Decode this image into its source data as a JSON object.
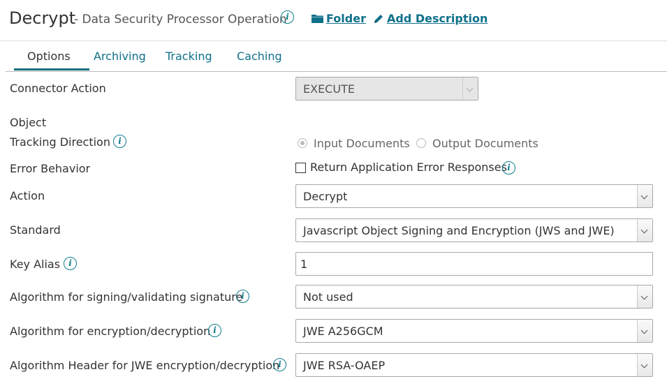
{
  "header": {
    "title": "Decrypt",
    "subtitle": "- Data Security Processor Operation",
    "folder_link": "Folder",
    "add_description_link": "Add Description"
  },
  "tabs": [
    {
      "label": "Options",
      "active": true
    },
    {
      "label": "Archiving",
      "active": false
    },
    {
      "label": "Tracking",
      "active": false
    },
    {
      "label": "Caching",
      "active": false
    }
  ],
  "form": {
    "connector_action": {
      "label": "Connector Action",
      "value": "EXECUTE",
      "disabled": true
    },
    "object": {
      "label": "Object"
    },
    "tracking_direction": {
      "label": "Tracking Direction",
      "options": [
        "Input Documents",
        "Output Documents"
      ],
      "selected": "Input Documents",
      "disabled": true
    },
    "error_behavior": {
      "label": "Error Behavior",
      "checkbox_label": "Return Application Error Responses",
      "checked": false
    },
    "action": {
      "label": "Action",
      "value": "Decrypt"
    },
    "standard": {
      "label": "Standard",
      "value": "Javascript Object Signing and Encryption (JWS and JWE)"
    },
    "key_alias": {
      "label": "Key Alias",
      "value": "1"
    },
    "signing_algorithm": {
      "label": "Algorithm for signing/validating signature",
      "value": "Not used"
    },
    "encryption_algorithm": {
      "label": "Algorithm for encryption/decryption",
      "value": "JWE A256GCM"
    },
    "header_algorithm": {
      "label": "Algorithm Header for JWE encryption/decryption",
      "value": "JWE RSA-OAEP"
    }
  },
  "colors": {
    "accent": "#10708a",
    "info_icon": "#0f7c8c",
    "active_tab_underline": "#0f6e7d"
  },
  "icons": {
    "info": "info-icon",
    "folder": "folder-icon",
    "pencil": "pencil-icon",
    "dropdown": "chevron-down-icon"
  }
}
